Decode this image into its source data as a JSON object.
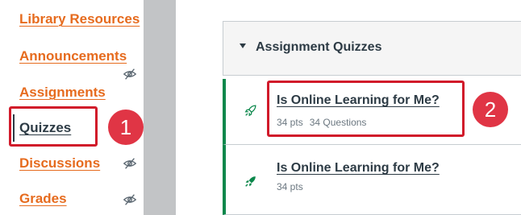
{
  "course_nav": {
    "items": [
      {
        "label": "Library Resources",
        "hidden": false,
        "active": false
      },
      {
        "label": "Announcements",
        "hidden": true,
        "active": false
      },
      {
        "label": "Assignments",
        "hidden": false,
        "active": false
      },
      {
        "label": "Quizzes",
        "hidden": false,
        "active": true
      },
      {
        "label": "Discussions",
        "hidden": true,
        "active": false
      },
      {
        "label": "Grades",
        "hidden": true,
        "active": false
      }
    ]
  },
  "annotations": {
    "step1": "1",
    "step2": "2"
  },
  "quiz_group": {
    "title": "Assignment Quizzes",
    "quizzes": [
      {
        "title": "Is Online Learning for Me?",
        "points": "34 pts",
        "questions": "34 Questions",
        "icon": "rocket-outline-icon"
      },
      {
        "title": "Is Online Learning for Me?",
        "points": "34 pts",
        "icon": "rocket-solid-icon"
      }
    ]
  },
  "colors": {
    "link_orange": "#e66b1e",
    "text_dark": "#2d3b45",
    "published_green": "#0b874b",
    "annotation_red": "#d11a2a"
  }
}
